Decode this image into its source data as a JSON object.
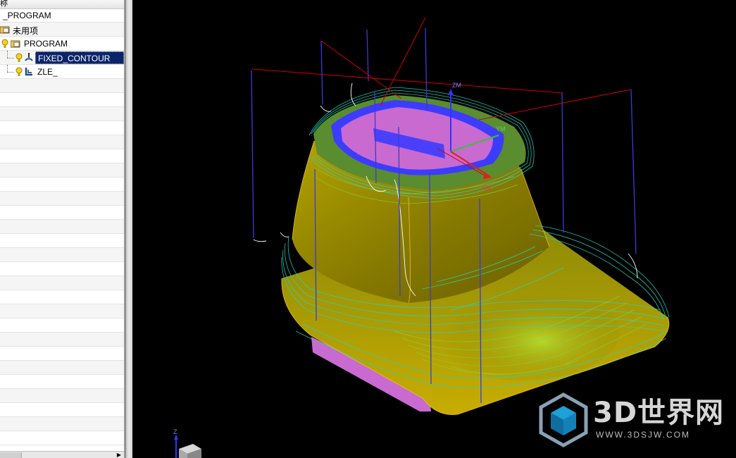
{
  "navigator": {
    "header_label": "称",
    "items": [
      {
        "label": "_PROGRAM",
        "icon": "none"
      },
      {
        "label": "未用项",
        "icon": "folder-icon"
      },
      {
        "label": "PROGRAM",
        "icon": "folder-icon"
      },
      {
        "label": "FIXED_CONTOUR",
        "icon": "fixed-contour-operation-icon",
        "selected": true
      },
      {
        "label": "ZLE_",
        "icon": "zlevel-operation-icon"
      }
    ]
  },
  "viewport": {
    "wcs_labels": {
      "z": "ZM",
      "y": "YM",
      "x": "XM"
    },
    "triad_labels": {
      "z": "Z"
    },
    "colors": {
      "part_body": "#8a7d00",
      "toolpath": "#20d8c0",
      "pink_face": "#c86ad0",
      "blue_rim": "#3c3cff",
      "red_line": "#d00000",
      "vertical_path": "#3a3ad6"
    }
  },
  "watermark": {
    "title": "3D世界网",
    "url": "WWW.3DSJW.COM"
  }
}
